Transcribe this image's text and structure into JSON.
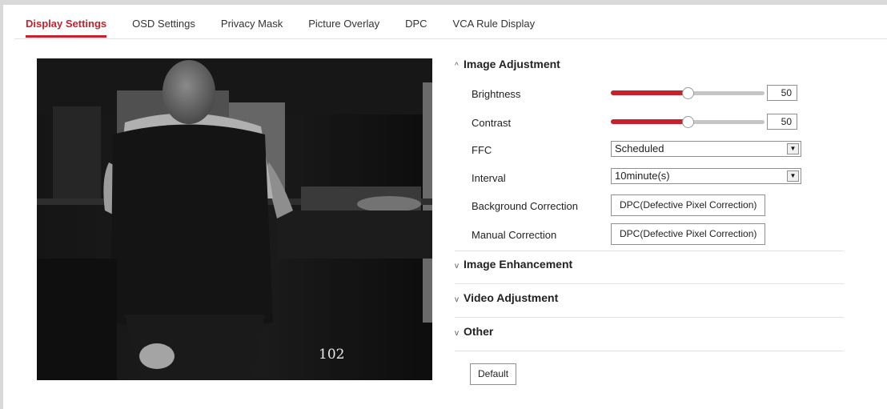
{
  "tabs": [
    {
      "label": "Display Settings",
      "active": true
    },
    {
      "label": "OSD Settings"
    },
    {
      "label": "Privacy Mask"
    },
    {
      "label": "Picture Overlay"
    },
    {
      "label": "DPC"
    },
    {
      "label": "VCA Rule Display"
    }
  ],
  "video": {
    "osd_number": "102"
  },
  "image_adjustment": {
    "title": "Image Adjustment",
    "expanded": true,
    "brightness": {
      "label": "Brightness",
      "value": "50",
      "level": 0.5
    },
    "contrast": {
      "label": "Contrast",
      "value": "50",
      "level": 0.5
    },
    "ffc": {
      "label": "FFC",
      "value": "Scheduled"
    },
    "interval": {
      "label": "Interval",
      "value": "10minute(s)"
    },
    "background_correction": {
      "label": "Background Correction",
      "button": "DPC(Defective Pixel Correction)"
    },
    "manual_correction": {
      "label": "Manual Correction",
      "button": "DPC(Defective Pixel Correction)"
    }
  },
  "sections": {
    "image_enhancement": "Image Enhancement",
    "video_adjustment": "Video Adjustment",
    "other": "Other"
  },
  "buttons": {
    "default": "Default"
  },
  "colors": {
    "accent": "#c8202c",
    "track": "#c5c5c5"
  },
  "icons": {
    "expanded": "chevron-up-icon",
    "collapsed": "chevron-down-icon",
    "dropdown": "dropdown-arrow-icon"
  }
}
